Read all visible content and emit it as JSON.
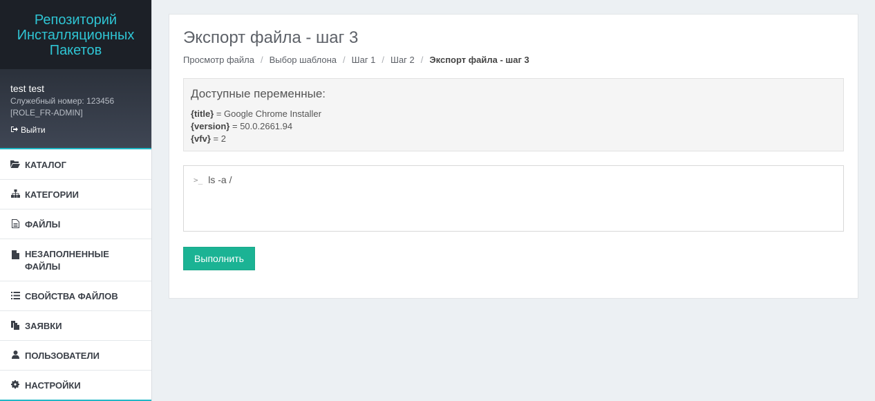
{
  "brand": {
    "title": "Репозиторий Инсталляционных Пакетов"
  },
  "profile": {
    "name": "test test",
    "employee_id": "Служебный номер: 123456",
    "role": "[ROLE_FR-ADMIN]",
    "logout_label": "Выйти"
  },
  "sidebar": {
    "items": [
      {
        "label": "КАТАЛОГ",
        "icon": "folder-open-icon"
      },
      {
        "label": "КАТЕГОРИИ",
        "icon": "sitemap-icon"
      },
      {
        "label": "ФАЙЛЫ",
        "icon": "file-text-icon"
      },
      {
        "label": "НЕЗАПОЛНЕННЫЕ ФАЙЛЫ",
        "icon": "file-icon"
      },
      {
        "label": "СВОЙСТВА ФАЙЛОВ",
        "icon": "list-icon"
      },
      {
        "label": "ЗАЯВКИ",
        "icon": "copy-icon"
      },
      {
        "label": "ПОЛЬЗОВАТЕЛИ",
        "icon": "user-icon"
      },
      {
        "label": "НАСТРОЙКИ",
        "icon": "gear-icon"
      }
    ]
  },
  "main": {
    "title": "Экспорт файла - шаг 3",
    "breadcrumb": [
      "Просмотр файла",
      "Выбор шаблона",
      "Шаг 1",
      "Шаг 2",
      "Экспорт файла - шаг 3"
    ],
    "vars_title": "Доступные переменные:",
    "variables": [
      {
        "key": "{title}",
        "value": " = Google Chrome Installer"
      },
      {
        "key": "{version}",
        "value": " = 50.0.2661.94"
      },
      {
        "key": "{vfv}",
        "value": " = 2"
      }
    ],
    "console": {
      "prompt": ">_",
      "command": "ls -a /"
    },
    "run_label": "Выполнить"
  },
  "colors": {
    "accent": "#1bb394",
    "brand_text": "#2fc5d4",
    "sidebar_dark": "#1c2027"
  }
}
